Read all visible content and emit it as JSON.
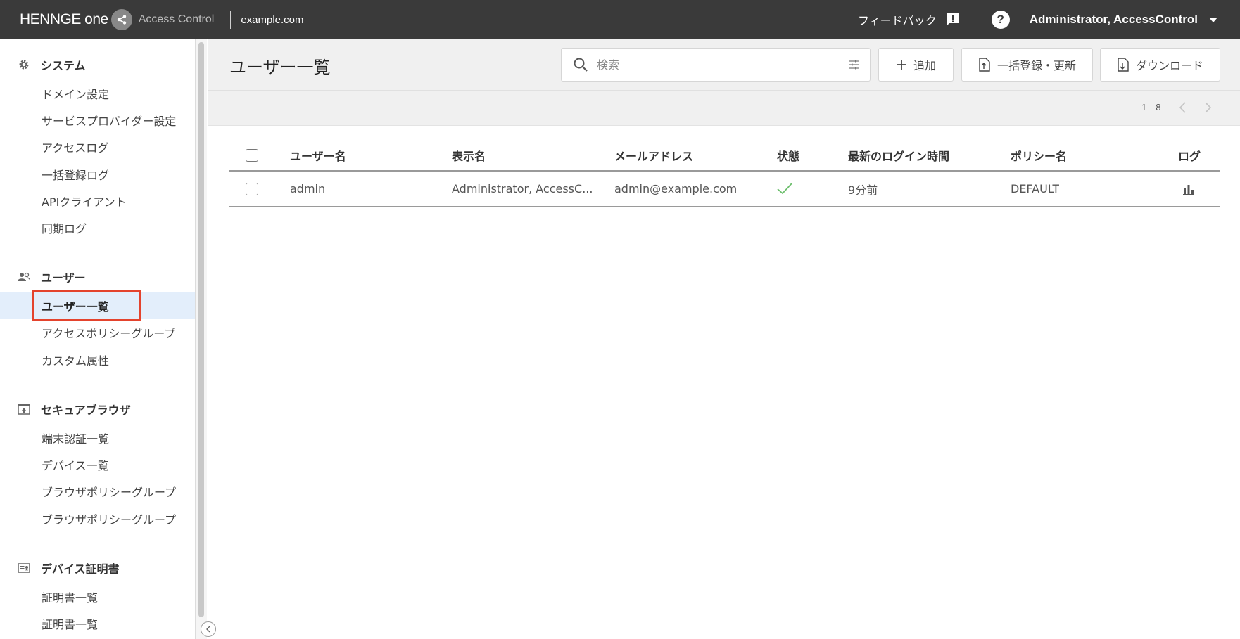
{
  "topbar": {
    "brand": "HENNGE one",
    "product": "Access Control",
    "domain": "example.com",
    "feedback_label": "フィードバック",
    "help_label": "?",
    "account_name": "Administrator, AccessControl"
  },
  "sidebar": {
    "system": {
      "title": "システム",
      "icon": "gear-icon",
      "items": [
        "ドメイン設定",
        "サービスプロバイダー設定",
        "アクセスログ",
        "一括登録ログ",
        "APIクライアント",
        "同期ログ"
      ]
    },
    "users": {
      "title": "ユーザー",
      "icon": "users-icon",
      "items": [
        "ユーザー一覧",
        "アクセスポリシーグループ",
        "カスタム属性"
      ],
      "active_index": 0
    },
    "secure_browser": {
      "title": "セキュアブラウザ",
      "icon": "secure-browser-icon",
      "items": [
        "端末認証一覧",
        "デバイス一覧",
        "ブラウザポリシーグループ",
        "ブラウザポリシーグループ"
      ]
    },
    "device_cert": {
      "title": "デバイス証明書",
      "icon": "certificate-icon",
      "items": [
        "証明書一覧",
        "証明書一覧"
      ]
    }
  },
  "main": {
    "title": "ユーザー一覧",
    "search_placeholder": "検索",
    "add_label": "追加",
    "bulk_label": "一括登録・更新",
    "download_label": "ダウンロード",
    "pager_range": "1—8"
  },
  "table": {
    "columns": [
      "ユーザー名",
      "表示名",
      "メールアドレス",
      "状態",
      "最新のログイン時間",
      "ポリシー名",
      "ログ"
    ],
    "rows": [
      {
        "username": "admin",
        "display_name": "Administrator, AccessC...",
        "email": "admin@example.com",
        "status": "active",
        "last_login": "9分前",
        "policy": "DEFAULT"
      }
    ]
  },
  "colors": {
    "topbar": "#3a3a3a",
    "active_bg": "#e3eefb",
    "highlight": "#e4432d",
    "check": "#6dbf6d"
  }
}
